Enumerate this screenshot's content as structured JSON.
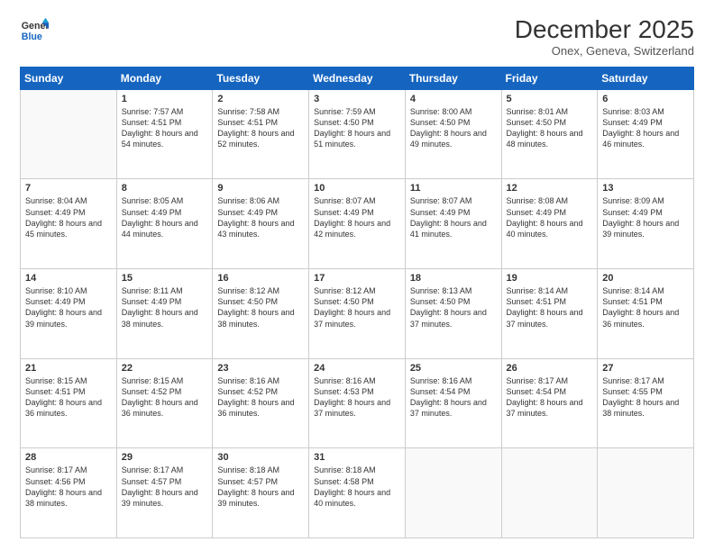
{
  "header": {
    "logo_line1": "General",
    "logo_line2": "Blue",
    "month": "December 2025",
    "location": "Onex, Geneva, Switzerland"
  },
  "days_of_week": [
    "Sunday",
    "Monday",
    "Tuesday",
    "Wednesday",
    "Thursday",
    "Friday",
    "Saturday"
  ],
  "weeks": [
    [
      {
        "day": "",
        "sunrise": "",
        "sunset": "",
        "daylight": "",
        "empty": true
      },
      {
        "day": "1",
        "sunrise": "Sunrise: 7:57 AM",
        "sunset": "Sunset: 4:51 PM",
        "daylight": "Daylight: 8 hours and 54 minutes."
      },
      {
        "day": "2",
        "sunrise": "Sunrise: 7:58 AM",
        "sunset": "Sunset: 4:51 PM",
        "daylight": "Daylight: 8 hours and 52 minutes."
      },
      {
        "day": "3",
        "sunrise": "Sunrise: 7:59 AM",
        "sunset": "Sunset: 4:50 PM",
        "daylight": "Daylight: 8 hours and 51 minutes."
      },
      {
        "day": "4",
        "sunrise": "Sunrise: 8:00 AM",
        "sunset": "Sunset: 4:50 PM",
        "daylight": "Daylight: 8 hours and 49 minutes."
      },
      {
        "day": "5",
        "sunrise": "Sunrise: 8:01 AM",
        "sunset": "Sunset: 4:50 PM",
        "daylight": "Daylight: 8 hours and 48 minutes."
      },
      {
        "day": "6",
        "sunrise": "Sunrise: 8:03 AM",
        "sunset": "Sunset: 4:49 PM",
        "daylight": "Daylight: 8 hours and 46 minutes."
      }
    ],
    [
      {
        "day": "7",
        "sunrise": "Sunrise: 8:04 AM",
        "sunset": "Sunset: 4:49 PM",
        "daylight": "Daylight: 8 hours and 45 minutes."
      },
      {
        "day": "8",
        "sunrise": "Sunrise: 8:05 AM",
        "sunset": "Sunset: 4:49 PM",
        "daylight": "Daylight: 8 hours and 44 minutes."
      },
      {
        "day": "9",
        "sunrise": "Sunrise: 8:06 AM",
        "sunset": "Sunset: 4:49 PM",
        "daylight": "Daylight: 8 hours and 43 minutes."
      },
      {
        "day": "10",
        "sunrise": "Sunrise: 8:07 AM",
        "sunset": "Sunset: 4:49 PM",
        "daylight": "Daylight: 8 hours and 42 minutes."
      },
      {
        "day": "11",
        "sunrise": "Sunrise: 8:07 AM",
        "sunset": "Sunset: 4:49 PM",
        "daylight": "Daylight: 8 hours and 41 minutes."
      },
      {
        "day": "12",
        "sunrise": "Sunrise: 8:08 AM",
        "sunset": "Sunset: 4:49 PM",
        "daylight": "Daylight: 8 hours and 40 minutes."
      },
      {
        "day": "13",
        "sunrise": "Sunrise: 8:09 AM",
        "sunset": "Sunset: 4:49 PM",
        "daylight": "Daylight: 8 hours and 39 minutes."
      }
    ],
    [
      {
        "day": "14",
        "sunrise": "Sunrise: 8:10 AM",
        "sunset": "Sunset: 4:49 PM",
        "daylight": "Daylight: 8 hours and 39 minutes."
      },
      {
        "day": "15",
        "sunrise": "Sunrise: 8:11 AM",
        "sunset": "Sunset: 4:49 PM",
        "daylight": "Daylight: 8 hours and 38 minutes."
      },
      {
        "day": "16",
        "sunrise": "Sunrise: 8:12 AM",
        "sunset": "Sunset: 4:50 PM",
        "daylight": "Daylight: 8 hours and 38 minutes."
      },
      {
        "day": "17",
        "sunrise": "Sunrise: 8:12 AM",
        "sunset": "Sunset: 4:50 PM",
        "daylight": "Daylight: 8 hours and 37 minutes."
      },
      {
        "day": "18",
        "sunrise": "Sunrise: 8:13 AM",
        "sunset": "Sunset: 4:50 PM",
        "daylight": "Daylight: 8 hours and 37 minutes."
      },
      {
        "day": "19",
        "sunrise": "Sunrise: 8:14 AM",
        "sunset": "Sunset: 4:51 PM",
        "daylight": "Daylight: 8 hours and 37 minutes."
      },
      {
        "day": "20",
        "sunrise": "Sunrise: 8:14 AM",
        "sunset": "Sunset: 4:51 PM",
        "daylight": "Daylight: 8 hours and 36 minutes."
      }
    ],
    [
      {
        "day": "21",
        "sunrise": "Sunrise: 8:15 AM",
        "sunset": "Sunset: 4:51 PM",
        "daylight": "Daylight: 8 hours and 36 minutes."
      },
      {
        "day": "22",
        "sunrise": "Sunrise: 8:15 AM",
        "sunset": "Sunset: 4:52 PM",
        "daylight": "Daylight: 8 hours and 36 minutes."
      },
      {
        "day": "23",
        "sunrise": "Sunrise: 8:16 AM",
        "sunset": "Sunset: 4:52 PM",
        "daylight": "Daylight: 8 hours and 36 minutes."
      },
      {
        "day": "24",
        "sunrise": "Sunrise: 8:16 AM",
        "sunset": "Sunset: 4:53 PM",
        "daylight": "Daylight: 8 hours and 37 minutes."
      },
      {
        "day": "25",
        "sunrise": "Sunrise: 8:16 AM",
        "sunset": "Sunset: 4:54 PM",
        "daylight": "Daylight: 8 hours and 37 minutes."
      },
      {
        "day": "26",
        "sunrise": "Sunrise: 8:17 AM",
        "sunset": "Sunset: 4:54 PM",
        "daylight": "Daylight: 8 hours and 37 minutes."
      },
      {
        "day": "27",
        "sunrise": "Sunrise: 8:17 AM",
        "sunset": "Sunset: 4:55 PM",
        "daylight": "Daylight: 8 hours and 38 minutes."
      }
    ],
    [
      {
        "day": "28",
        "sunrise": "Sunrise: 8:17 AM",
        "sunset": "Sunset: 4:56 PM",
        "daylight": "Daylight: 8 hours and 38 minutes."
      },
      {
        "day": "29",
        "sunrise": "Sunrise: 8:17 AM",
        "sunset": "Sunset: 4:57 PM",
        "daylight": "Daylight: 8 hours and 39 minutes."
      },
      {
        "day": "30",
        "sunrise": "Sunrise: 8:18 AM",
        "sunset": "Sunset: 4:57 PM",
        "daylight": "Daylight: 8 hours and 39 minutes."
      },
      {
        "day": "31",
        "sunrise": "Sunrise: 8:18 AM",
        "sunset": "Sunset: 4:58 PM",
        "daylight": "Daylight: 8 hours and 40 minutes."
      },
      {
        "day": "",
        "empty": true
      },
      {
        "day": "",
        "empty": true
      },
      {
        "day": "",
        "empty": true
      }
    ]
  ]
}
